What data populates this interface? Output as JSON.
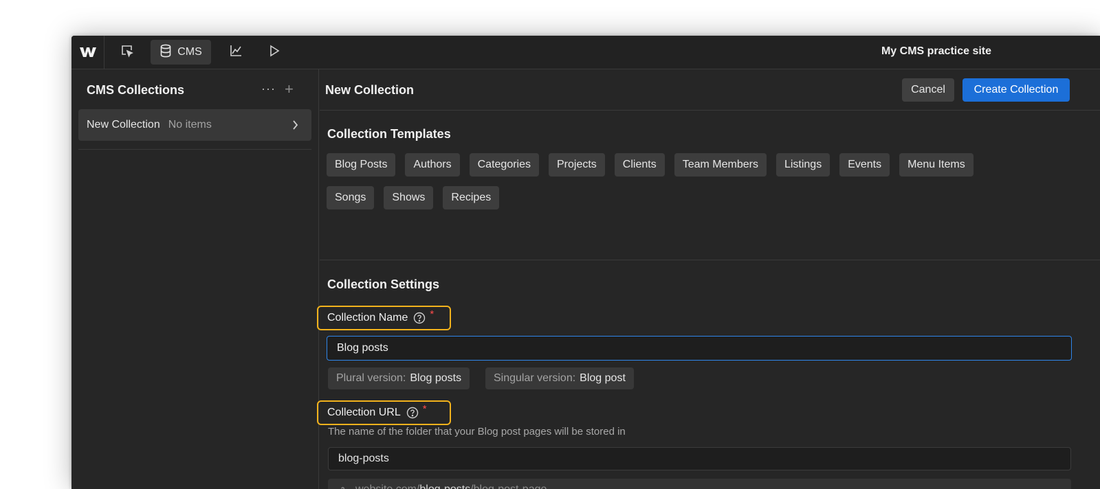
{
  "topbar": {
    "site_title": "My CMS practice site",
    "tools": [
      {
        "icon": "selector-icon"
      },
      {
        "icon": "database-icon",
        "label": "CMS",
        "active": true
      },
      {
        "icon": "analytics-icon"
      },
      {
        "icon": "play-icon"
      }
    ]
  },
  "sidebar": {
    "title": "CMS Collections",
    "more_label": "···",
    "add_label": "+",
    "items": [
      {
        "name": "New Collection",
        "count": "No items"
      }
    ]
  },
  "main": {
    "title": "New Collection",
    "cancel_label": "Cancel",
    "create_label": "Create Collection",
    "templates_title": "Collection Templates",
    "templates": [
      "Blog Posts",
      "Authors",
      "Categories",
      "Projects",
      "Clients",
      "Team Members",
      "Listings",
      "Events",
      "Menu Items",
      "Songs",
      "Shows",
      "Recipes"
    ],
    "settings_title": "Collection Settings",
    "name_field": {
      "label": "Collection Name",
      "required": "*",
      "value": "Blog posts",
      "plural_key": "Plural version:",
      "plural_value": "Blog posts",
      "singular_key": "Singular version:",
      "singular_value": "Blog post"
    },
    "url_field": {
      "label": "Collection URL",
      "required": "*",
      "description": "The name of the folder that your Blog post pages will be stored in",
      "value": "blog-posts",
      "preview_domain": "website.com/",
      "preview_slug": "blog-posts",
      "preview_page": "/blog-post-page"
    }
  },
  "colors": {
    "accent": "#1c6fd8",
    "highlight": "#f2b21c",
    "required": "#ff4b4b",
    "panel": "#262626"
  }
}
